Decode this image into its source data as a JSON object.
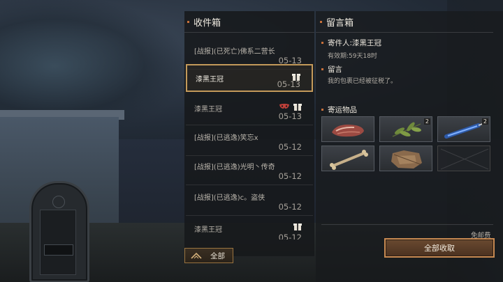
{
  "inbox": {
    "title": "收件箱",
    "items": [
      {
        "subject": "[战报](已死亡)佛系二营长",
        "date": "05-13",
        "gift": false,
        "mask": false,
        "active": false
      },
      {
        "subject": "漆黑王冠",
        "date": "05-13",
        "gift": true,
        "mask": false,
        "active": true
      },
      {
        "subject": "漆黑王冠",
        "date": "05-13",
        "gift": true,
        "mask": true,
        "active": false
      },
      {
        "subject": "[战报](已逃逸)笑忘x",
        "date": "05-12",
        "gift": false,
        "mask": false,
        "active": false
      },
      {
        "subject": "[战报](已逃逸)光明丶传奇",
        "date": "05-12",
        "gift": false,
        "mask": false,
        "active": false
      },
      {
        "subject": "[战报](已逃逸)c。盗侠",
        "date": "05-12",
        "gift": false,
        "mask": false,
        "active": false
      },
      {
        "subject": "漆黑王冠",
        "date": "05-12",
        "gift": true,
        "mask": false,
        "active": false
      }
    ],
    "all_button": "全部"
  },
  "message": {
    "title": "留言箱",
    "sender_label": "寄件人:漆黑王冠",
    "validity": "有效期:59天18时",
    "note_title": "留言",
    "note_text": "我的包裹已经被征税了。",
    "items_title": "寄运物品",
    "items": [
      {
        "name": "raw-meat",
        "qty": ""
      },
      {
        "name": "herb-leaves",
        "qty": "2"
      },
      {
        "name": "blue-syringe",
        "qty": "2"
      },
      {
        "name": "bone",
        "qty": ""
      },
      {
        "name": "animal-hide",
        "qty": ""
      },
      {
        "name": "empty",
        "qty": ""
      }
    ],
    "free_postage": "免邮费",
    "claim_all": "全部收取"
  },
  "colors": {
    "accent": "#c8703a",
    "gold_border": "#c49a5a",
    "panel": "#16181b"
  }
}
